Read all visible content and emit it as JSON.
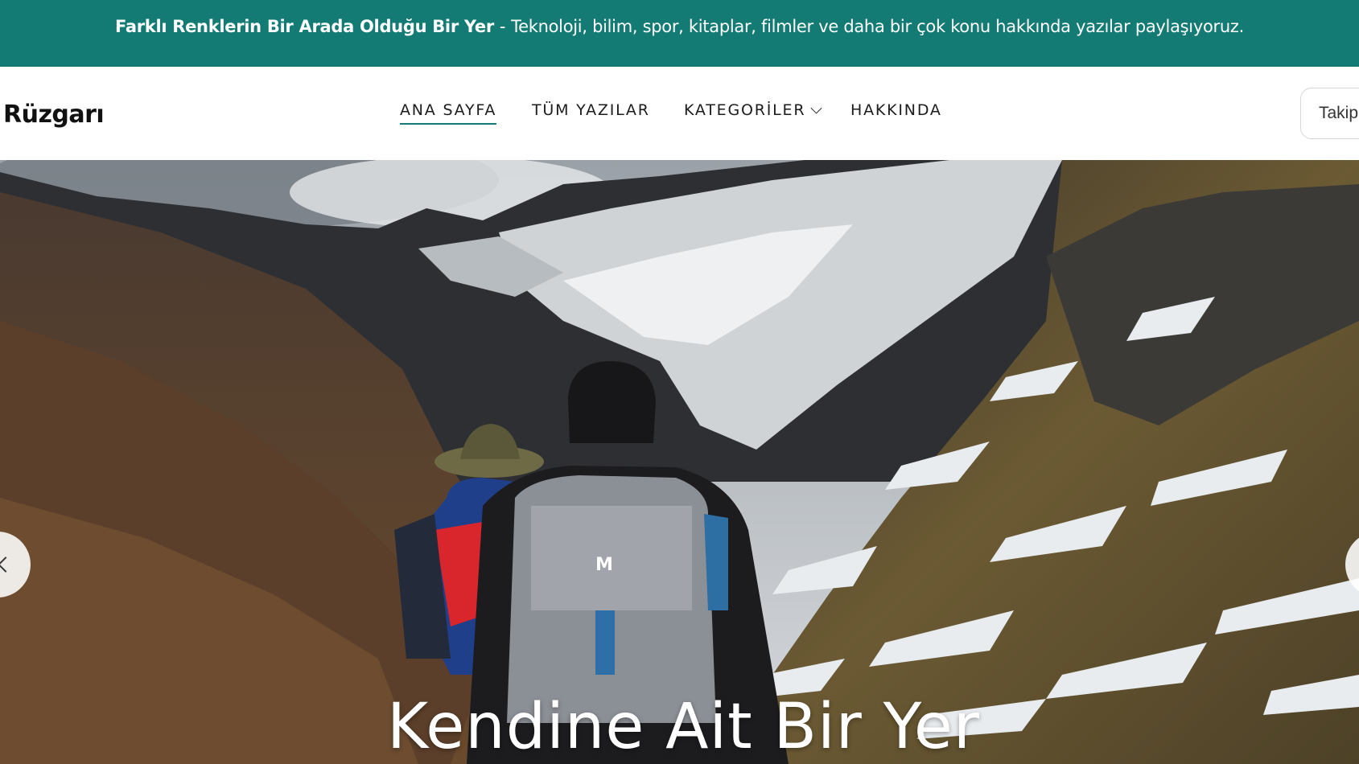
{
  "announcement": {
    "highlight": "Farklı Renklerin Bir Arada Olduğu Bir Yer",
    "separator": "-",
    "text": "Teknoloji, bilim, spor, kitaplar, filmler ve daha bir çok konu hakkında yazılar paylaşıyoruz."
  },
  "header": {
    "brand": "Rüzgarı",
    "nav": [
      {
        "label": "ANA SAYFA",
        "active": true
      },
      {
        "label": "TÜM YAZILAR",
        "active": false
      },
      {
        "label": "KATEGORİLER",
        "active": false,
        "dropdown": true
      },
      {
        "label": "HAKKINDA",
        "active": false
      }
    ],
    "follow_label": "Takip"
  },
  "hero": {
    "title": "Kendine Ait Bir Yer",
    "prev_icon": "chevron-left-icon",
    "next_icon": "chevron-right-icon"
  },
  "colors": {
    "topbar": "#137b74",
    "accent": "#137b74"
  }
}
